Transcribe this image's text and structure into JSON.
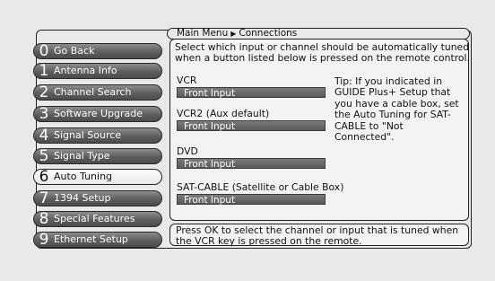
{
  "breadcrumb": {
    "root": "Main Menu",
    "separator_icon": "right-triangle-arrow",
    "current": "Connections"
  },
  "menu": {
    "items": [
      {
        "number": "0",
        "label": "Go Back"
      },
      {
        "number": "1",
        "label": "Antenna Info"
      },
      {
        "number": "2",
        "label": "Channel Search"
      },
      {
        "number": "3",
        "label": "Software Upgrade"
      },
      {
        "number": "4",
        "label": "Signal Source"
      },
      {
        "number": "5",
        "label": "Signal Type"
      },
      {
        "number": "6",
        "label": "Auto Tuning"
      },
      {
        "number": "7",
        "label": "1394 Setup"
      },
      {
        "number": "8",
        "label": "Special Features"
      },
      {
        "number": "9",
        "label": "Ethernet Setup"
      }
    ],
    "active_index": 6
  },
  "intro": "Select which input or channel should be automatically tuned when a button listed below is pressed on the remote control.",
  "fields": [
    {
      "label": "VCR",
      "value": "Front Input"
    },
    {
      "label": "VCR2 (Aux default)",
      "value": "Front Input"
    },
    {
      "label": "DVD",
      "value": "Front Input"
    },
    {
      "label": "SAT-CABLE (Satellite or Cable Box)",
      "value": "Front Input"
    }
  ],
  "tip": "Tip: If you indicated in GUIDE Plus+ Setup that you have a cable box, set the Auto Tuning for SAT-CABLE to \"Not Connected\".",
  "footer_help": "Press OK to select the channel or input that is tuned when the VCR key is pressed on the remote.",
  "colors": {
    "background": "#e9e9e9",
    "menu_button": "#5e5e5e",
    "menu_active": "#f5f5f5",
    "field_value_bg": "#6a6a6a"
  }
}
